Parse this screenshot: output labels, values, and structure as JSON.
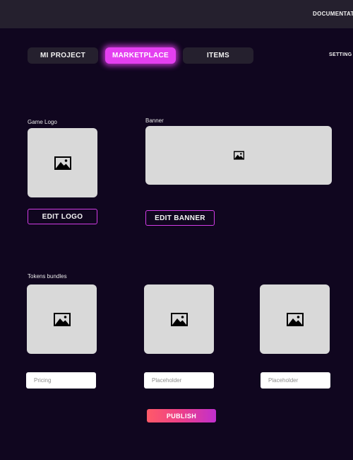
{
  "topbar": {
    "documentation_label": "DOCUMENTAT"
  },
  "settings_label": "SETTING",
  "tabs": [
    {
      "label": "MI PROJECT",
      "active": false
    },
    {
      "label": "MARKETPLACE",
      "active": true
    },
    {
      "label": "ITEMS",
      "active": false
    }
  ],
  "logo_section": {
    "label": "Game Logo",
    "edit_button": "EDIT LOGO",
    "placeholder_icon": "image-icon"
  },
  "banner_section": {
    "label": "Banner",
    "edit_button": "EDIT BANNER",
    "placeholder_icon": "image-icon"
  },
  "tokens_section": {
    "label": "Tokens bundles",
    "bundles": [
      {
        "icon": "image-icon",
        "input_placeholder": "Pricing"
      },
      {
        "icon": "image-icon",
        "input_placeholder": "Placeholder"
      },
      {
        "icon": "image-icon",
        "input_placeholder": "Placeholder"
      }
    ]
  },
  "publish_button": "PUBLISH",
  "colors": {
    "background": "#10061f",
    "surface": "#25202e",
    "accent": "#e43ff0",
    "placeholder_box": "#d9d9d9",
    "publish_gradient_start": "#ff5a68",
    "publish_gradient_end": "#c12fce"
  }
}
